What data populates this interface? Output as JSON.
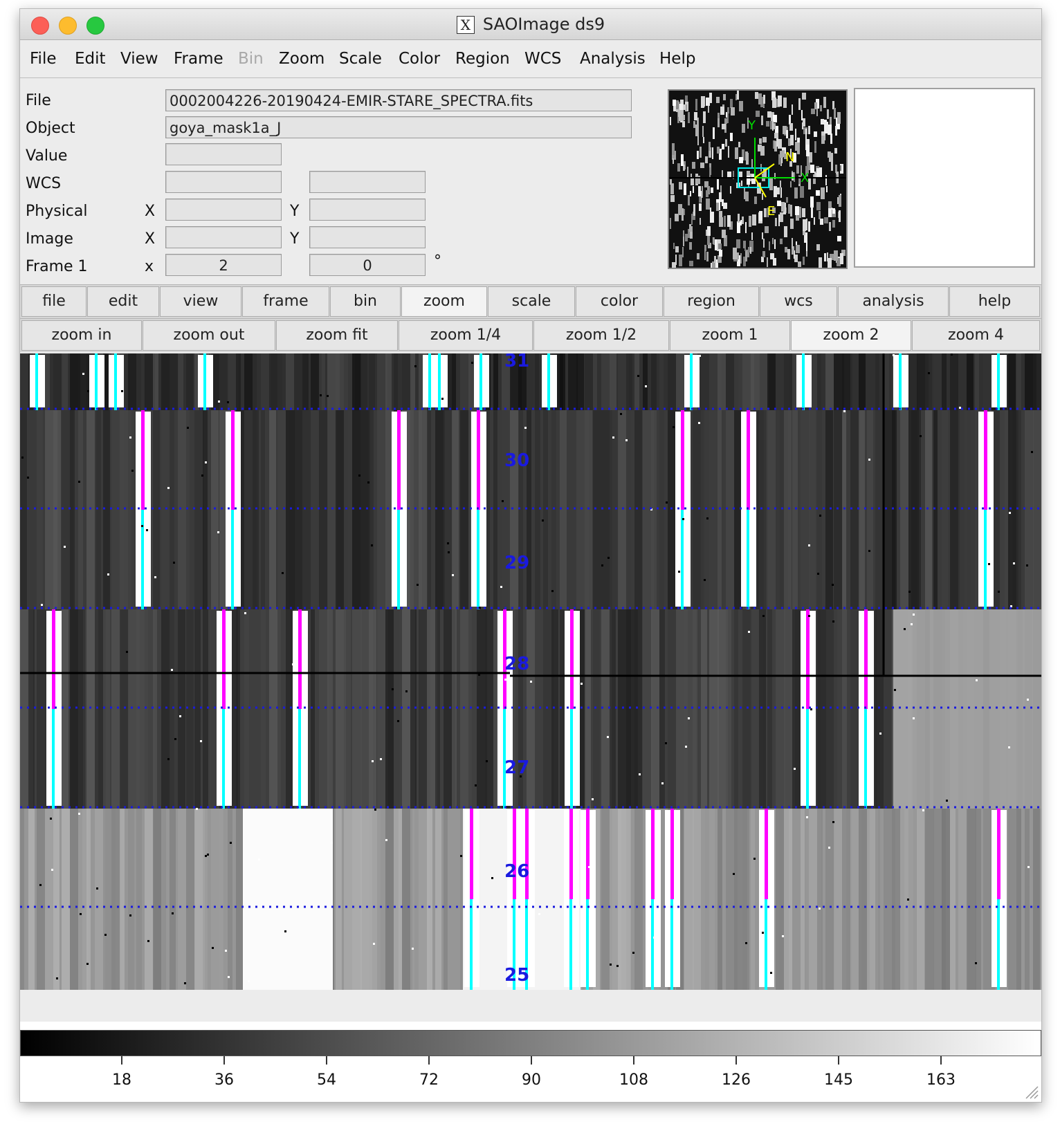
{
  "window": {
    "title": "SAOImage ds9"
  },
  "menu": [
    "File",
    "Edit",
    "View",
    "Frame",
    "Bin",
    "Zoom",
    "Scale",
    "Color",
    "Region",
    "WCS",
    "Analysis",
    "Help"
  ],
  "menu_disabled": "Bin",
  "info": {
    "file_label": "File",
    "file_value": "0002004226-20190424-EMIR-STARE_SPECTRA.fits",
    "object_label": "Object",
    "object_value": "goya_mask1a_J",
    "value_label": "Value",
    "wcs_label": "WCS",
    "physical_label": "Physical",
    "image_label": "Image",
    "frame_label": "Frame 1",
    "x_upper": "X",
    "y_upper": "Y",
    "x_lower": "x",
    "frame_zoom": "2",
    "frame_angle": "0",
    "degree": "°"
  },
  "panner": {
    "axis_x": "X",
    "axis_y": "Y",
    "north": "N",
    "east": "E"
  },
  "buttonbar": [
    "file",
    "edit",
    "view",
    "frame",
    "bin",
    "zoom",
    "scale",
    "color",
    "region",
    "wcs",
    "analysis",
    "help"
  ],
  "buttonbar_active": "zoom",
  "zoombar": [
    "zoom in",
    "zoom out",
    "zoom fit",
    "zoom 1/4",
    "zoom 1/2",
    "zoom 1",
    "zoom 2",
    "zoom 4"
  ],
  "zoombar_active": "zoom 2",
  "slit_labels": [
    "31",
    "30",
    "29",
    "28",
    "27",
    "26",
    "25"
  ],
  "colorbar_ticks": [
    "18",
    "36",
    "54",
    "72",
    "90",
    "108",
    "126",
    "145",
    "163"
  ],
  "colors": {
    "magenta": "#ff00ff",
    "cyan": "#00ffff",
    "region_blue": "#1a1adf"
  }
}
